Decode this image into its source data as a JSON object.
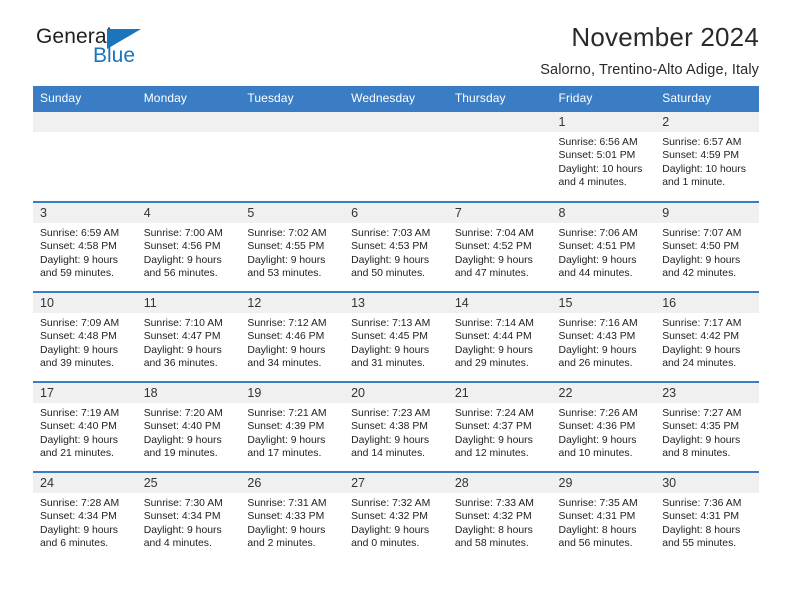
{
  "brand": {
    "name_part1": "General",
    "name_part2": "Blue",
    "triangle_icon": "triangle-icon",
    "colors": {
      "dark": "#231f20",
      "blue": "#1b75bb"
    }
  },
  "header": {
    "title": "November 2024",
    "subtitle": "Salorno, Trentino-Alto Adige, Italy"
  },
  "theme": {
    "header_blue": "#3b7dc4",
    "daynum_bg": "#f0f0f0",
    "text": "#222222"
  },
  "calendar": {
    "weekday_headers": [
      "Sunday",
      "Monday",
      "Tuesday",
      "Wednesday",
      "Thursday",
      "Friday",
      "Saturday"
    ],
    "weeks": [
      [
        {
          "day": "",
          "empty": true
        },
        {
          "day": "",
          "empty": true
        },
        {
          "day": "",
          "empty": true
        },
        {
          "day": "",
          "empty": true
        },
        {
          "day": "",
          "empty": true
        },
        {
          "day": "1",
          "sunrise": "Sunrise: 6:56 AM",
          "sunset": "Sunset: 5:01 PM",
          "daylight": "Daylight: 10 hours and 4 minutes."
        },
        {
          "day": "2",
          "sunrise": "Sunrise: 6:57 AM",
          "sunset": "Sunset: 4:59 PM",
          "daylight": "Daylight: 10 hours and 1 minute."
        }
      ],
      [
        {
          "day": "3",
          "sunrise": "Sunrise: 6:59 AM",
          "sunset": "Sunset: 4:58 PM",
          "daylight": "Daylight: 9 hours and 59 minutes."
        },
        {
          "day": "4",
          "sunrise": "Sunrise: 7:00 AM",
          "sunset": "Sunset: 4:56 PM",
          "daylight": "Daylight: 9 hours and 56 minutes."
        },
        {
          "day": "5",
          "sunrise": "Sunrise: 7:02 AM",
          "sunset": "Sunset: 4:55 PM",
          "daylight": "Daylight: 9 hours and 53 minutes."
        },
        {
          "day": "6",
          "sunrise": "Sunrise: 7:03 AM",
          "sunset": "Sunset: 4:53 PM",
          "daylight": "Daylight: 9 hours and 50 minutes."
        },
        {
          "day": "7",
          "sunrise": "Sunrise: 7:04 AM",
          "sunset": "Sunset: 4:52 PM",
          "daylight": "Daylight: 9 hours and 47 minutes."
        },
        {
          "day": "8",
          "sunrise": "Sunrise: 7:06 AM",
          "sunset": "Sunset: 4:51 PM",
          "daylight": "Daylight: 9 hours and 44 minutes."
        },
        {
          "day": "9",
          "sunrise": "Sunrise: 7:07 AM",
          "sunset": "Sunset: 4:50 PM",
          "daylight": "Daylight: 9 hours and 42 minutes."
        }
      ],
      [
        {
          "day": "10",
          "sunrise": "Sunrise: 7:09 AM",
          "sunset": "Sunset: 4:48 PM",
          "daylight": "Daylight: 9 hours and 39 minutes."
        },
        {
          "day": "11",
          "sunrise": "Sunrise: 7:10 AM",
          "sunset": "Sunset: 4:47 PM",
          "daylight": "Daylight: 9 hours and 36 minutes."
        },
        {
          "day": "12",
          "sunrise": "Sunrise: 7:12 AM",
          "sunset": "Sunset: 4:46 PM",
          "daylight": "Daylight: 9 hours and 34 minutes."
        },
        {
          "day": "13",
          "sunrise": "Sunrise: 7:13 AM",
          "sunset": "Sunset: 4:45 PM",
          "daylight": "Daylight: 9 hours and 31 minutes."
        },
        {
          "day": "14",
          "sunrise": "Sunrise: 7:14 AM",
          "sunset": "Sunset: 4:44 PM",
          "daylight": "Daylight: 9 hours and 29 minutes."
        },
        {
          "day": "15",
          "sunrise": "Sunrise: 7:16 AM",
          "sunset": "Sunset: 4:43 PM",
          "daylight": "Daylight: 9 hours and 26 minutes."
        },
        {
          "day": "16",
          "sunrise": "Sunrise: 7:17 AM",
          "sunset": "Sunset: 4:42 PM",
          "daylight": "Daylight: 9 hours and 24 minutes."
        }
      ],
      [
        {
          "day": "17",
          "sunrise": "Sunrise: 7:19 AM",
          "sunset": "Sunset: 4:40 PM",
          "daylight": "Daylight: 9 hours and 21 minutes."
        },
        {
          "day": "18",
          "sunrise": "Sunrise: 7:20 AM",
          "sunset": "Sunset: 4:40 PM",
          "daylight": "Daylight: 9 hours and 19 minutes."
        },
        {
          "day": "19",
          "sunrise": "Sunrise: 7:21 AM",
          "sunset": "Sunset: 4:39 PM",
          "daylight": "Daylight: 9 hours and 17 minutes."
        },
        {
          "day": "20",
          "sunrise": "Sunrise: 7:23 AM",
          "sunset": "Sunset: 4:38 PM",
          "daylight": "Daylight: 9 hours and 14 minutes."
        },
        {
          "day": "21",
          "sunrise": "Sunrise: 7:24 AM",
          "sunset": "Sunset: 4:37 PM",
          "daylight": "Daylight: 9 hours and 12 minutes."
        },
        {
          "day": "22",
          "sunrise": "Sunrise: 7:26 AM",
          "sunset": "Sunset: 4:36 PM",
          "daylight": "Daylight: 9 hours and 10 minutes."
        },
        {
          "day": "23",
          "sunrise": "Sunrise: 7:27 AM",
          "sunset": "Sunset: 4:35 PM",
          "daylight": "Daylight: 9 hours and 8 minutes."
        }
      ],
      [
        {
          "day": "24",
          "sunrise": "Sunrise: 7:28 AM",
          "sunset": "Sunset: 4:34 PM",
          "daylight": "Daylight: 9 hours and 6 minutes."
        },
        {
          "day": "25",
          "sunrise": "Sunrise: 7:30 AM",
          "sunset": "Sunset: 4:34 PM",
          "daylight": "Daylight: 9 hours and 4 minutes."
        },
        {
          "day": "26",
          "sunrise": "Sunrise: 7:31 AM",
          "sunset": "Sunset: 4:33 PM",
          "daylight": "Daylight: 9 hours and 2 minutes."
        },
        {
          "day": "27",
          "sunrise": "Sunrise: 7:32 AM",
          "sunset": "Sunset: 4:32 PM",
          "daylight": "Daylight: 9 hours and 0 minutes."
        },
        {
          "day": "28",
          "sunrise": "Sunrise: 7:33 AM",
          "sunset": "Sunset: 4:32 PM",
          "daylight": "Daylight: 8 hours and 58 minutes."
        },
        {
          "day": "29",
          "sunrise": "Sunrise: 7:35 AM",
          "sunset": "Sunset: 4:31 PM",
          "daylight": "Daylight: 8 hours and 56 minutes."
        },
        {
          "day": "30",
          "sunrise": "Sunrise: 7:36 AM",
          "sunset": "Sunset: 4:31 PM",
          "daylight": "Daylight: 8 hours and 55 minutes."
        }
      ]
    ]
  }
}
